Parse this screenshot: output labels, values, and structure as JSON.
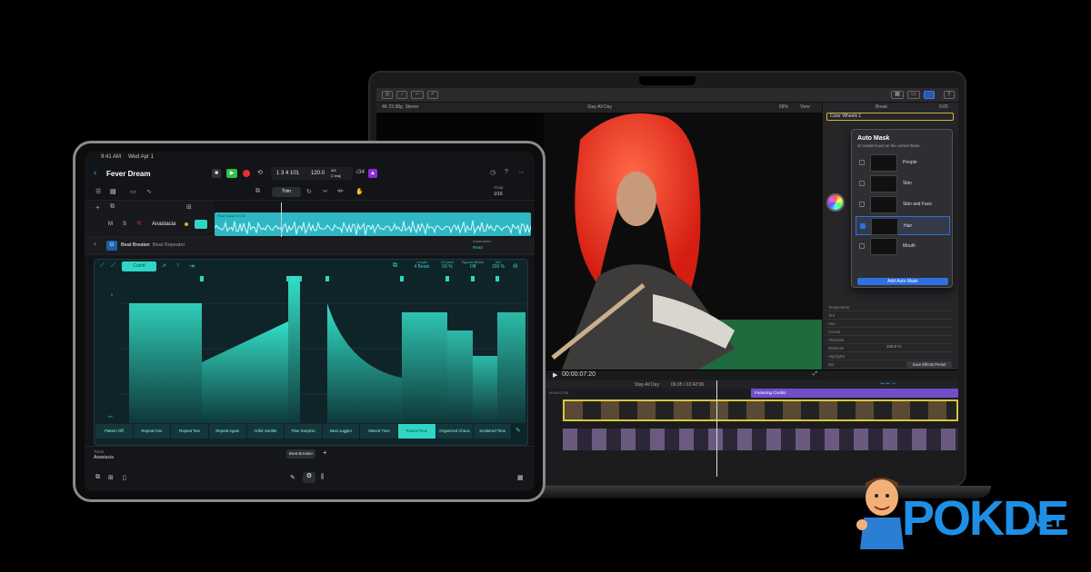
{
  "ipad": {
    "status_time": "9:41 AM",
    "status_date": "Wed Apr 1",
    "song_title": "Fever Dream",
    "lcd": {
      "position": "1 3 4 101",
      "tempo": "120.0",
      "time_sig": "4/4",
      "key": "C maj",
      "extra": "√34"
    },
    "mode": "Trim",
    "snap_label": "Snap",
    "snap_value": "1/16",
    "track": {
      "mute": "M",
      "solo": "S",
      "record": "R",
      "name": "Anastacia"
    },
    "region_name": "Flow Vocal 1'4 01",
    "plugin": {
      "name": "Beat Breaker",
      "preset": "Beat Repeater",
      "automation_label": "Automation",
      "automation_value": "Read"
    },
    "filter_mode": "Cutoff",
    "params": [
      {
        "label": "Length",
        "value": "4 Beats"
      },
      {
        "label": "On pitch",
        "value": "50 %"
      },
      {
        "label": "Bypass Below",
        "value": "Off"
      },
      {
        "label": "Mix",
        "value": "100 %"
      }
    ],
    "y_labels": [
      "0",
      "-inf"
    ],
    "patterns": [
      "Pattern Off",
      "Repeat One",
      "Repeat Two",
      "Repeat Again",
      "Artful Jumble",
      "Time Surprise",
      "Beat Juggler",
      "Altered Time",
      "Fractal Time",
      "Organized Chaos",
      "Scattered Time"
    ],
    "active_pattern": "Fractal Time",
    "bottom": {
      "track_label": "Track",
      "track_value": "Anastacia",
      "chip": "Beat Breaker",
      "add": "+"
    }
  },
  "mac": {
    "format": "4K 23.98p, Stereo",
    "project": "Stay All Day",
    "zoom": "68%",
    "view": "View",
    "effect": "Color Wheels 1",
    "inspector_title": "Break",
    "inspector_time": "0:05",
    "auto_mask": {
      "title": "Auto Mask",
      "subtitle": "10 masks found on the current frame.",
      "items": [
        "People",
        "Skin",
        "Skin and Face",
        "Hair",
        "Mouth"
      ],
      "selected": "Hair",
      "add_button": "Add Auto Mask"
    },
    "inspector_rows": [
      "Temperature",
      "Tint",
      "Hue",
      "Curves",
      "Shadows",
      "Midtones",
      "Highlights",
      "Mix"
    ],
    "mix_value": "100.0 %",
    "save_preset": "Save Effects Preset",
    "timecode": "00:00:07:20",
    "timeline_project": "Stay All Day",
    "timeline_time": "06:05 / 02:42:06",
    "title_clip": "Featuring Credits",
    "ruler_start": "00:00:07:00"
  },
  "brand": {
    "name": "POKDE",
    "suffix": ".NET"
  },
  "colors": {
    "accent_teal": "#2fd6c8",
    "record_red": "#e5322d",
    "play_green": "#2bc24a",
    "mask_blue": "#2f6fe0",
    "brand_blue": "#1f8fe5"
  }
}
